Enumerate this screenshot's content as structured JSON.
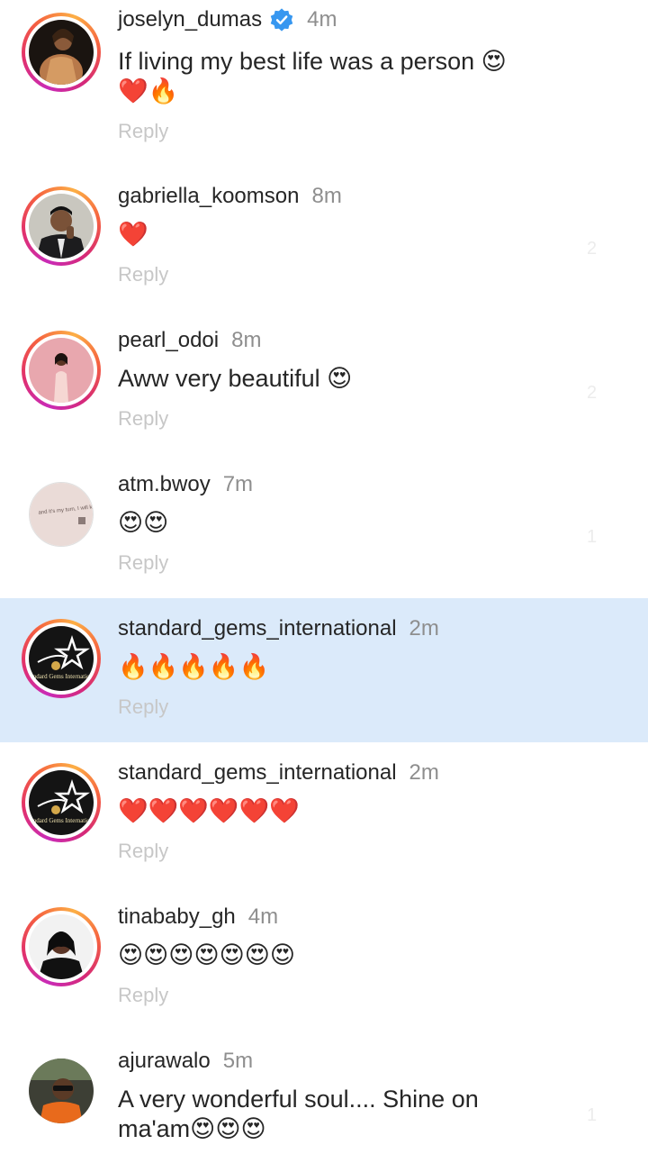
{
  "comments": [
    {
      "username": "joselyn_dumas",
      "verified": true,
      "time": "4m",
      "text": "If living my best life was a person 😍\n❤️🔥",
      "reply": "Reply",
      "likes": ""
    },
    {
      "username": "gabriella_koomson",
      "verified": false,
      "time": "8m",
      "text": "❤️",
      "reply": "Reply",
      "likes": "2"
    },
    {
      "username": "pearl_odoi",
      "verified": false,
      "time": "8m",
      "text": "Aww very beautiful 😍",
      "reply": "Reply",
      "likes": "2"
    },
    {
      "username": "atm.bwoy",
      "verified": false,
      "time": "7m",
      "text": "😍😍",
      "reply": "Reply",
      "likes": "1"
    },
    {
      "username": "standard_gems_international",
      "verified": false,
      "time": "2m",
      "text": "🔥🔥🔥🔥🔥",
      "reply": "Reply",
      "likes": "",
      "highlighted": true
    },
    {
      "username": "standard_gems_international",
      "verified": false,
      "time": "2m",
      "text": "❤️❤️❤️❤️❤️❤️",
      "reply": "Reply",
      "likes": ""
    },
    {
      "username": "tinababy_gh",
      "verified": false,
      "time": "4m",
      "text": "😍😍😍😍😍😍😍",
      "reply": "Reply",
      "likes": ""
    },
    {
      "username": "ajurawalo",
      "verified": false,
      "time": "5m",
      "text": "A very wonderful soul.... Shine on ma'am😍😍😍",
      "reply": "",
      "likes": "1"
    }
  ],
  "avatar_texts": {
    "atm_card": "and it's my turn, I will keep clapping for others.",
    "gems_logo": "Standard Gems International"
  },
  "colors": {
    "highlight": "#dbeafa",
    "verified": "#3797f0",
    "ring_start": "#c92bb7",
    "ring_end": "#fcaf45"
  }
}
